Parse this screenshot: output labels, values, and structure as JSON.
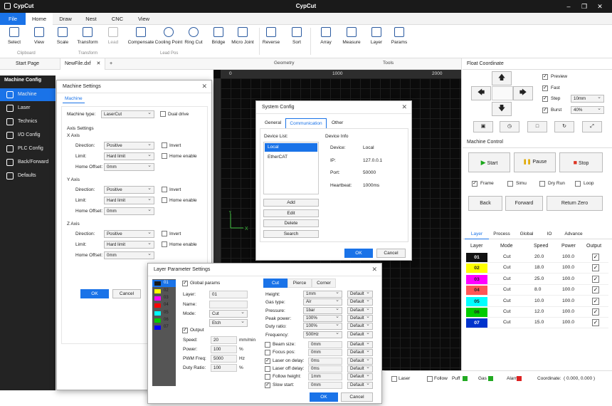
{
  "app": {
    "name": "CypCut",
    "title": "CypCut"
  },
  "menu": [
    "File",
    "Home",
    "Draw",
    "Nest",
    "CNC",
    "View"
  ],
  "ribbon": {
    "buttons": [
      "Select",
      "View",
      "Scale",
      "Transform",
      "Lead",
      "Compensate",
      "Cooling Point",
      "Ring Cut",
      "Bridge",
      "Micro Joint",
      "Reverse",
      "Sort",
      "Array",
      "Measure",
      "Layer",
      "Params"
    ],
    "groups": [
      "Clipboard",
      "Transform",
      "Lead Pos",
      "Geometry",
      "Tools"
    ]
  },
  "doc_tabs": [
    "Start Page",
    "NewFile.dxf"
  ],
  "canvas": {
    "ruler": [
      "0",
      "1000",
      "2000"
    ]
  },
  "sidebar": {
    "title": "Machine Config",
    "items": [
      "Machine",
      "Laser",
      "Technics",
      "I/O Config",
      "PLC Config",
      "Back/Forward",
      "Defaults"
    ]
  },
  "machine_settings": {
    "title": "Machine Settings",
    "tab": "Machine",
    "type_label": "Machine type:",
    "type_value": "LaserCut",
    "dual_drive": "Dual drive",
    "axis_settings": "Axis Settings",
    "axes": [
      {
        "name": "X Axis",
        "direction": "Positive",
        "limit": "Hard limit",
        "offset": "0mm"
      },
      {
        "name": "Y Axis",
        "direction": "Positive",
        "limit": "Hard limit",
        "offset": "0mm"
      },
      {
        "name": "Z Axis",
        "direction": "Positive",
        "limit": "Hard limit",
        "offset": "0mm"
      }
    ],
    "direction_label": "Direction:",
    "limit_label": "Limit:",
    "offset_label": "Home Offset:",
    "invert": "Invert",
    "home_enable": "Home enable",
    "ok": "OK",
    "cancel": "Cancel"
  },
  "system_config": {
    "title": "System Config",
    "tabs": [
      "General",
      "Communication",
      "Other"
    ],
    "device_list": "Device List:",
    "devices": [
      "Local",
      "EtherCAT"
    ],
    "device_info": "Device Info",
    "info": [
      {
        "k": "Device:",
        "v": "Local"
      },
      {
        "k": "IP:",
        "v": "127.0.0.1"
      },
      {
        "k": "Port:",
        "v": "50000"
      },
      {
        "k": "Heartbeat:",
        "v": "1000ms"
      }
    ],
    "actions": [
      "Add",
      "Edit",
      "Delete",
      "Search"
    ],
    "ok": "OK",
    "cancel": "Cancel"
  },
  "layer_params": {
    "title": "Layer Parameter Settings",
    "layers": [
      {
        "id": "01",
        "color": "#1a1a1a"
      },
      {
        "id": "02",
        "color": "#ffff00"
      },
      {
        "id": "03",
        "color": "#ff00ff"
      },
      {
        "id": "04",
        "color": "#ff0000"
      },
      {
        "id": "05",
        "color": "#00ffff"
      },
      {
        "id": "06",
        "color": "#00cc00"
      },
      {
        "id": "07",
        "color": "#0000ff"
      }
    ],
    "global_params": "Global params",
    "layer_label": "Layer:",
    "layer_value": "01",
    "name_label": "Name:",
    "mode_label": "Mode:",
    "mode_value": "Cut",
    "etch_value": "Etch",
    "output": "Output",
    "speed_label": "Speed:",
    "speed_value": "20",
    "speed_unit": "mm/min",
    "power_label": "Power:",
    "power_value": "100",
    "power_unit": "%",
    "pwm_label": "PWM Freq:",
    "pwm_value": "5000",
    "pwm_unit": "Hz",
    "duty_label": "Duty Ratio:",
    "duty_value": "100",
    "duty_unit": "%",
    "tabs": [
      "Cut",
      "Pierce",
      "Corner"
    ],
    "params": [
      {
        "k": "Height:",
        "v": "1mm",
        "d": "Default"
      },
      {
        "k": "Gas type:",
        "v": "Air",
        "d": "Default"
      },
      {
        "k": "Pressure:",
        "v": "1bar",
        "d": "Default"
      },
      {
        "k": "Peak power:",
        "v": "100%",
        "d": "Default"
      },
      {
        "k": "Duty ratio:",
        "v": "100%",
        "d": "Default"
      },
      {
        "k": "Frequency:",
        "v": "500Hz",
        "d": "Default"
      }
    ],
    "checks": [
      {
        "k": "Beam size:",
        "v": "0mm",
        "d": "Default",
        "c": false
      },
      {
        "k": "Focus pos:",
        "v": "0mm",
        "d": "Default",
        "c": false
      },
      {
        "k": "Laser on delay:",
        "v": "0ms",
        "d": "Default",
        "c": true
      },
      {
        "k": "Laser off delay:",
        "v": "0ms",
        "d": "Default",
        "c": false
      },
      {
        "k": "Follow height:",
        "v": "1mm",
        "d": "Default",
        "c": false
      },
      {
        "k": "Slow start:",
        "v": "0mm",
        "d": "Default",
        "c": true
      }
    ],
    "ok": "OK",
    "cancel": "Cancel"
  },
  "float_coord": {
    "title": "Float Coordinate",
    "options": [
      {
        "label": "Preview",
        "checked": true
      },
      {
        "label": "Fast",
        "checked": true
      },
      {
        "label": "Step",
        "checked": true,
        "value": "10mm"
      },
      {
        "label": "Burst",
        "checked": true,
        "value": "40%"
      }
    ]
  },
  "machine_control": {
    "title": "Machine Control",
    "start": "Start",
    "pause": "Pause",
    "stop": "Stop",
    "toggles": [
      {
        "label": "Frame",
        "checked": true
      },
      {
        "label": "Simu",
        "checked": false
      },
      {
        "label": "Dry Run",
        "checked": false
      },
      {
        "label": "Loop",
        "checked": false
      }
    ],
    "back": "Back",
    "forward": "Forward",
    "return_zero": "Return Zero"
  },
  "layer_panel": {
    "tabs": [
      "Layer",
      "Process",
      "Global",
      "IO",
      "Advance"
    ],
    "headers": [
      "Layer",
      "Mode",
      "Speed",
      "Power",
      "Output"
    ],
    "rows": [
      {
        "id": "01",
        "mode": "Cut",
        "speed": "20.0",
        "power": "100.0",
        "color": "#111111",
        "fg": "#ffffff"
      },
      {
        "id": "02",
        "mode": "Cut",
        "speed": "18.0",
        "power": "100.0",
        "color": "#ffff00",
        "fg": "#222"
      },
      {
        "id": "03",
        "mode": "Cut",
        "speed": "25.0",
        "power": "100.0",
        "color": "#ff00ff",
        "fg": "#222"
      },
      {
        "id": "04",
        "mode": "Cut",
        "speed": "8.0",
        "power": "100.0",
        "color": "#ff5555",
        "fg": "#222"
      },
      {
        "id": "05",
        "mode": "Cut",
        "speed": "10.0",
        "power": "100.0",
        "color": "#00ffff",
        "fg": "#222"
      },
      {
        "id": "06",
        "mode": "Cut",
        "speed": "12.0",
        "power": "100.0",
        "color": "#00cc00",
        "fg": "#222"
      },
      {
        "id": "07",
        "mode": "Cut",
        "speed": "15.0",
        "power": "100.0",
        "color": "#0033cc",
        "fg": "#ffffff"
      }
    ]
  },
  "status": {
    "laser": "Laser",
    "follow": "Follow",
    "puff": "Puff",
    "gas": "Gas",
    "alarm": "Alarm",
    "coord_label": "Coordinate:",
    "coord_value": "( 0.000, 0.000 )",
    "puff_color": "#22aa22",
    "gas_color": "#22aa22",
    "alarm_color": "#dd2222"
  }
}
